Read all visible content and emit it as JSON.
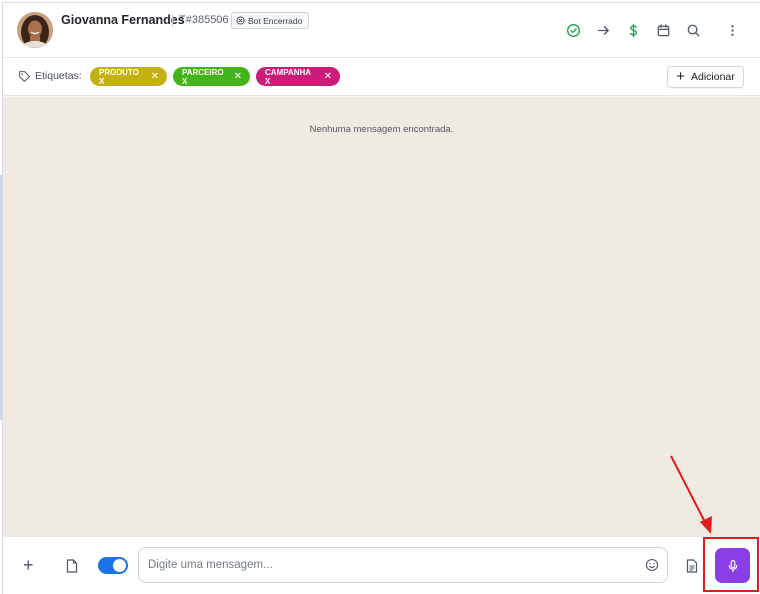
{
  "header": {
    "contact_name": "Giovanna Fernandes",
    "ticket_id": "T#385506",
    "bot_status": "Bot Encerrado",
    "actions": [
      {
        "icon": "check-circle-icon",
        "color": "#16a34a"
      },
      {
        "icon": "arrow-right-icon",
        "color": "#4b5563"
      },
      {
        "icon": "dollar-sign-icon",
        "color": "#16a34a"
      },
      {
        "icon": "calendar-icon",
        "color": "#4b5563"
      },
      {
        "icon": "search-icon",
        "color": "#4b5563"
      },
      {
        "icon": "more-vertical-icon",
        "color": "#4b5563"
      }
    ]
  },
  "tags": {
    "label": "Etiquetas:",
    "items": [
      {
        "text": "PRODUTO X",
        "color": "#c4b10f"
      },
      {
        "text": "PARCEIRO X",
        "color": "#43b51a"
      },
      {
        "text": "CAMPANHA X",
        "color": "#cc1c78"
      }
    ],
    "add_label": "Adicionar"
  },
  "chat": {
    "empty_message": "Nenhuma mensagem encontrada."
  },
  "composer": {
    "placeholder": "Digite uma mensagem...",
    "toggle_on": true,
    "mic_color": "#8a3ee6"
  },
  "annotation": {
    "color": "#e01c1c"
  }
}
